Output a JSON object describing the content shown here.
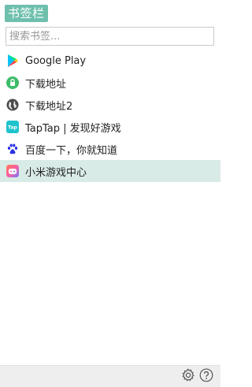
{
  "header": {
    "title": "书签栏"
  },
  "search": {
    "placeholder": "搜索书签..."
  },
  "bookmarks": [
    {
      "label": "Google Play",
      "icon": "google-play-icon"
    },
    {
      "label": "下载地址",
      "icon": "android-lock-icon"
    },
    {
      "label": "下载地址2",
      "icon": "globe-icon"
    },
    {
      "label": "TapTap | 发现好游戏",
      "icon": "taptap-icon",
      "icon_text": "Tap"
    },
    {
      "label": "百度一下，你就知道",
      "icon": "baidu-paw-icon"
    },
    {
      "label": "小米游戏中心",
      "icon": "xiaomi-game-center-icon",
      "selected": true
    }
  ],
  "footer": {
    "settings_icon": "gear-icon",
    "help_icon": "help-icon"
  },
  "colors": {
    "accent": "#6ec0ad",
    "selected_row": "#d9ebe7",
    "footer_bg": "#eeeeee"
  }
}
